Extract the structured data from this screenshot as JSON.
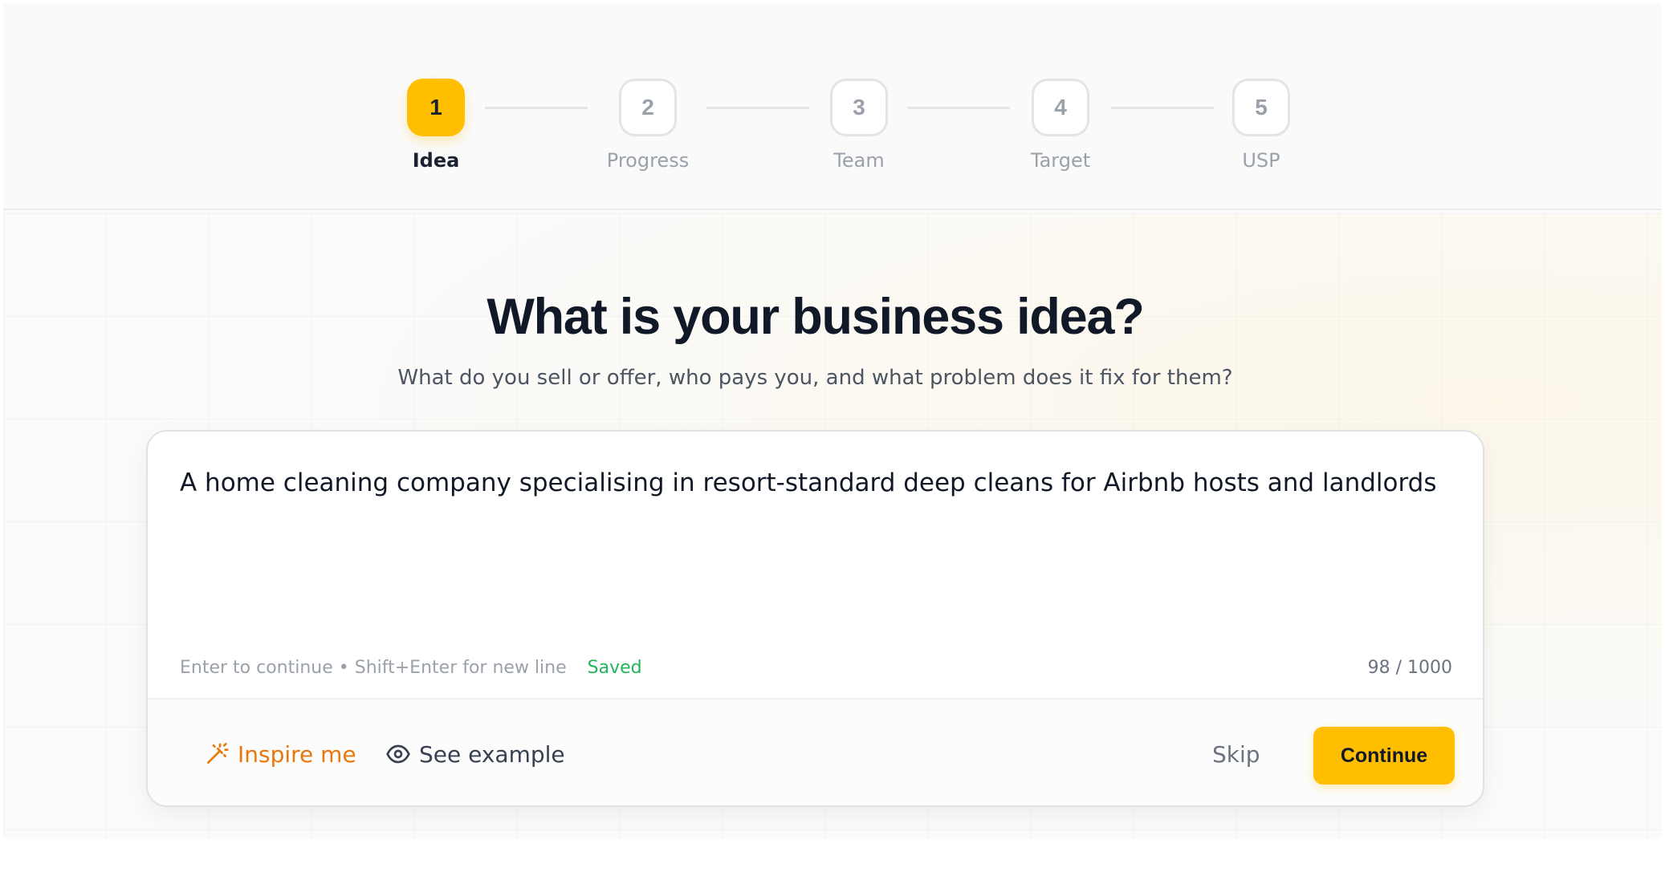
{
  "stepper": {
    "steps": [
      {
        "number": "1",
        "label": "Idea",
        "state": "active"
      },
      {
        "number": "2",
        "label": "Progress",
        "state": "upcoming"
      },
      {
        "number": "3",
        "label": "Team",
        "state": "upcoming"
      },
      {
        "number": "4",
        "label": "Target",
        "state": "upcoming"
      },
      {
        "number": "5",
        "label": "USP",
        "state": "upcoming"
      }
    ]
  },
  "question": {
    "title": "What is your business idea?",
    "subtitle": "What do you sell or offer, who pays you, and what problem does it fix for them?"
  },
  "answer": {
    "value": "A home cleaning company specialising in resort-standard deep cleans for Airbnb hosts and landlords",
    "hint": "Enter to continue • Shift+Enter for new line",
    "save_status": "Saved",
    "char_count": "98 / 1000"
  },
  "actions": {
    "inspire_label": "Inspire me",
    "inspire_icon": "magic-wand-icon",
    "example_label": "See example",
    "example_icon": "eye-icon",
    "skip_label": "Skip",
    "continue_label": "Continue"
  },
  "colors": {
    "accent": "#ffbf00",
    "inspire": "#e8780c",
    "saved": "#22b45a",
    "heading": "#111827"
  }
}
